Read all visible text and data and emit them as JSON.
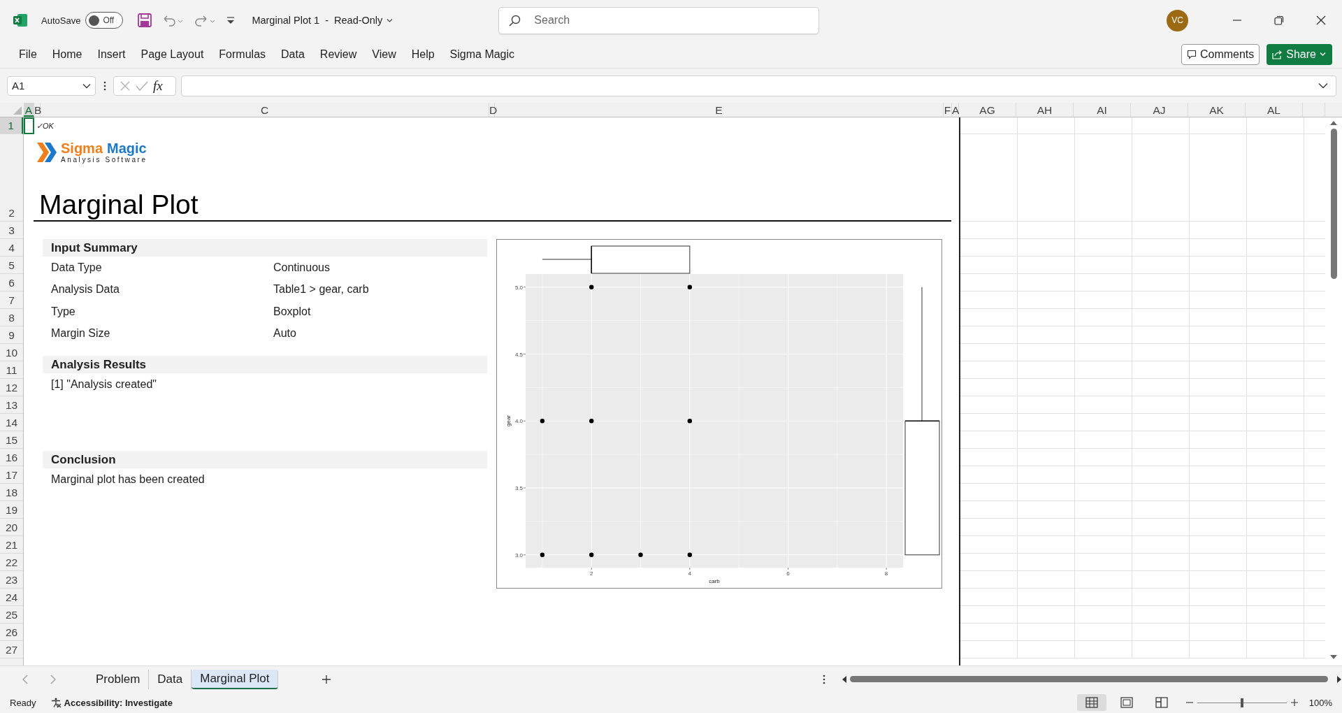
{
  "title_bar": {
    "autosave": {
      "label": "AutoSave",
      "state": "Off",
      "on": false
    },
    "document_title": "Marginal Plot 1  -  Read-Only",
    "search": {
      "placeholder": "Search"
    },
    "avatar": "VC"
  },
  "ribbon_tabs": [
    "File",
    "Home",
    "Insert",
    "Page Layout",
    "Formulas",
    "Data",
    "Review",
    "View",
    "Help",
    "Sigma Magic"
  ],
  "ribbon_buttons": {
    "comments": "Comments",
    "share": "Share"
  },
  "formula_bar": {
    "name_box": "A1",
    "function_button": "fx"
  },
  "column_headers": [
    {
      "label": "A",
      "selected": true
    },
    {
      "label": "B",
      "selected": false
    },
    {
      "label": "C",
      "selected": false
    },
    {
      "label": "D",
      "selected": false
    },
    {
      "label": "E",
      "selected": false
    },
    {
      "label": "F",
      "selected": false
    },
    {
      "label": "A",
      "selected": false
    },
    {
      "label": "AG",
      "selected": false
    },
    {
      "label": "AH",
      "selected": false
    },
    {
      "label": "AI",
      "selected": false
    },
    {
      "label": "AJ",
      "selected": false
    },
    {
      "label": "AK",
      "selected": false
    },
    {
      "label": "AL",
      "selected": false
    }
  ],
  "row_headers": [
    {
      "label": "1",
      "selected": true
    },
    {
      "label": "2",
      "selected": false
    },
    {
      "label": "3",
      "selected": false
    },
    {
      "label": "4",
      "selected": false
    },
    {
      "label": "5",
      "selected": false
    },
    {
      "label": "6",
      "selected": false
    },
    {
      "label": "7",
      "selected": false
    },
    {
      "label": "8",
      "selected": false
    },
    {
      "label": "9",
      "selected": false
    },
    {
      "label": "10",
      "selected": false
    },
    {
      "label": "11",
      "selected": false
    },
    {
      "label": "12",
      "selected": false
    },
    {
      "label": "13",
      "selected": false
    },
    {
      "label": "14",
      "selected": false
    },
    {
      "label": "15",
      "selected": false
    },
    {
      "label": "16",
      "selected": false
    },
    {
      "label": "17",
      "selected": false
    },
    {
      "label": "18",
      "selected": false
    },
    {
      "label": "19",
      "selected": false
    },
    {
      "label": "20",
      "selected": false
    },
    {
      "label": "21",
      "selected": false
    },
    {
      "label": "22",
      "selected": false
    },
    {
      "label": "23",
      "selected": false
    },
    {
      "label": "24",
      "selected": false
    },
    {
      "label": "25",
      "selected": false
    },
    {
      "label": "26",
      "selected": false
    },
    {
      "label": "27",
      "selected": false
    }
  ],
  "report": {
    "status": "✓OK",
    "logo": {
      "words": [
        {
          "text": "Sigma",
          "color": "#f07f1b"
        },
        {
          "text": "Magic",
          "color": "#1c78c8"
        }
      ],
      "tagline": "Analysis Software"
    },
    "title": "Marginal Plot",
    "sections": [
      {
        "heading": "Input Summary",
        "rows": [
          {
            "label": "Data Type",
            "value": "Continuous"
          },
          {
            "label": "Analysis Data",
            "value": "Table1 > gear, carb"
          },
          {
            "label": "Type",
            "value": "Boxplot"
          },
          {
            "label": "Margin Size",
            "value": "Auto"
          }
        ]
      },
      {
        "heading": "Analysis Results",
        "lines": [
          "[1] \"Analysis created\""
        ]
      },
      {
        "heading": "Conclusion",
        "lines": [
          "Marginal plot has been created"
        ]
      }
    ],
    "chart_data": {
      "type": "scatter",
      "grid": true,
      "xlabel": "carb",
      "ylabel": "gear",
      "x": [
        1,
        1,
        2,
        2,
        2,
        3,
        4,
        4,
        4
      ],
      "series": [
        {
          "color": "#000000",
          "values": [
            4,
            3,
            5,
            4,
            3,
            3,
            5,
            4,
            3
          ]
        }
      ],
      "xlim": [
        0.66,
        8.34
      ],
      "ylim": [
        2.905,
        5.098
      ],
      "xticks": [
        2,
        4,
        6,
        8
      ],
      "yticks": [
        {
          "value": 3,
          "label": "3.0"
        },
        {
          "value": 3.5,
          "label": "3.5"
        },
        {
          "value": 4,
          "label": "4.0"
        },
        {
          "value": 4.5,
          "label": "4.5"
        },
        {
          "value": 5,
          "label": "5.0"
        }
      ]
    }
  },
  "sheet_tabs": [
    {
      "label": "Problem",
      "selected": false
    },
    {
      "label": "Data",
      "selected": false
    },
    {
      "label": "Marginal Plot",
      "selected": true
    }
  ],
  "status_bar": {
    "status": "Ready",
    "accessibility": "Accessibility: Investigate",
    "views": [
      {
        "kind": "normal",
        "selected": true
      },
      {
        "kind": "page_layout",
        "selected": false
      },
      {
        "kind": "page_break",
        "selected": false
      }
    ],
    "zoom": {
      "level": 0.5,
      "reading": "100%"
    }
  }
}
